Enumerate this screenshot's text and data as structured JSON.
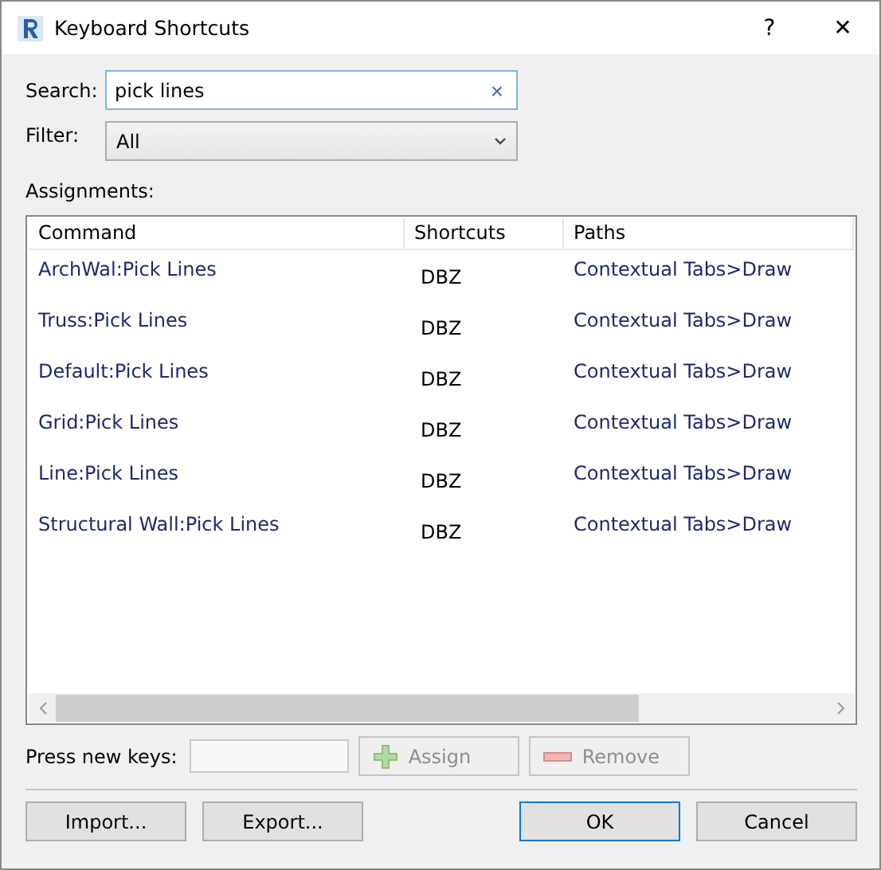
{
  "window": {
    "title": "Keyboard Shortcuts",
    "help": "?",
    "close": "✕"
  },
  "search": {
    "label": "Search:",
    "value": "pick lines",
    "clear": "×"
  },
  "filter": {
    "label": "Filter:",
    "value": "All"
  },
  "assignments": {
    "label": "Assignments:",
    "columns": [
      "Command",
      "Shortcuts",
      "Paths"
    ],
    "rows": [
      {
        "command": "ArchWal:Pick Lines",
        "shortcut": "DBZ",
        "path": "Contextual Tabs>Draw"
      },
      {
        "command": "Truss:Pick Lines",
        "shortcut": "DBZ",
        "path": "Contextual Tabs>Draw"
      },
      {
        "command": "Default:Pick Lines",
        "shortcut": "DBZ",
        "path": "Contextual Tabs>Draw"
      },
      {
        "command": "Grid:Pick Lines",
        "shortcut": "DBZ",
        "path": "Contextual Tabs>Draw"
      },
      {
        "command": "Line:Pick Lines",
        "shortcut": "DBZ",
        "path": "Contextual Tabs>Draw"
      },
      {
        "command": "Structural Wall:Pick Lines",
        "shortcut": "DBZ",
        "path": "Contextual Tabs>Draw"
      }
    ]
  },
  "new_keys": {
    "label": "Press new keys:",
    "buttons": [
      {
        "kind": "assign",
        "label": "Assign",
        "disabled": true
      },
      {
        "kind": "remove",
        "label": "Remove",
        "disabled": true
      }
    ]
  },
  "footer_buttons": [
    {
      "label": "Import...",
      "default": false
    },
    {
      "label": "Export...",
      "default": false
    },
    {
      "label": "OK",
      "default": true
    },
    {
      "label": "Cancel",
      "default": false
    }
  ]
}
